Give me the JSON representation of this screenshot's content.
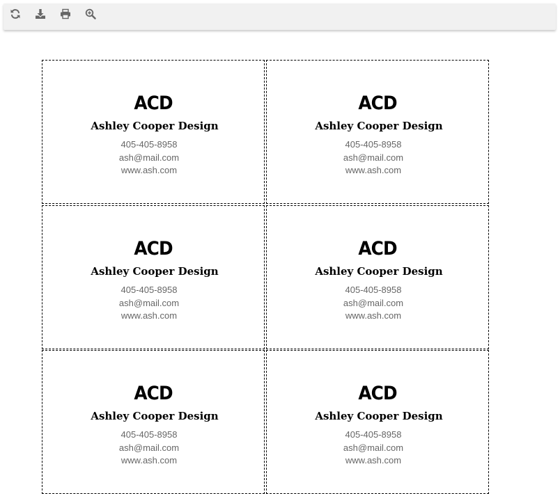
{
  "toolbar": {
    "buttons": [
      {
        "name": "refresh-button",
        "icon": "refresh-icon"
      },
      {
        "name": "download-button",
        "icon": "download-icon"
      },
      {
        "name": "print-button",
        "icon": "print-icon"
      },
      {
        "name": "zoom-in-button",
        "icon": "zoom-in-icon"
      }
    ],
    "icon_color": "#666666"
  },
  "cards": [
    {
      "abbr": "ACD",
      "company": "Ashley Cooper Design",
      "phone": "405-405-8958",
      "email": "ash@mail.com",
      "website": "www.ash.com"
    },
    {
      "abbr": "ACD",
      "company": "Ashley Cooper Design",
      "phone": "405-405-8958",
      "email": "ash@mail.com",
      "website": "www.ash.com"
    },
    {
      "abbr": "ACD",
      "company": "Ashley Cooper Design",
      "phone": "405-405-8958",
      "email": "ash@mail.com",
      "website": "www.ash.com"
    },
    {
      "abbr": "ACD",
      "company": "Ashley Cooper Design",
      "phone": "405-405-8958",
      "email": "ash@mail.com",
      "website": "www.ash.com"
    },
    {
      "abbr": "ACD",
      "company": "Ashley Cooper Design",
      "phone": "405-405-8958",
      "email": "ash@mail.com",
      "website": "www.ash.com"
    },
    {
      "abbr": "ACD",
      "company": "Ashley Cooper Design",
      "phone": "405-405-8958",
      "email": "ash@mail.com",
      "website": "www.ash.com"
    }
  ]
}
